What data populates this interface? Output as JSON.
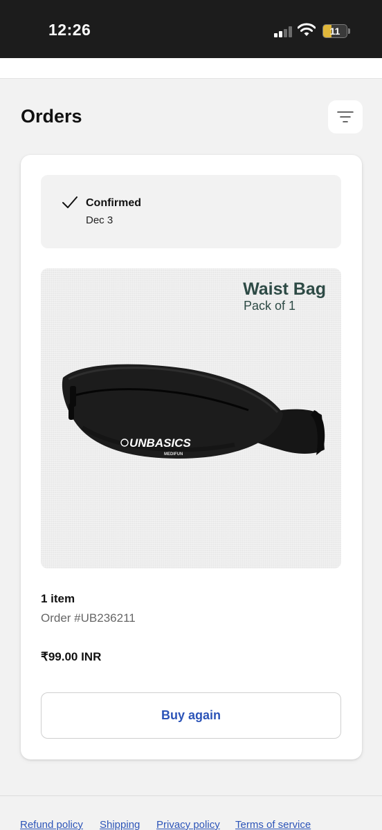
{
  "status_bar": {
    "time": "12:26",
    "battery_level": "11",
    "icons": [
      "signal-icon",
      "wifi-icon",
      "battery-icon"
    ]
  },
  "header": {
    "title": "Orders",
    "filter_icon": "filter-icon"
  },
  "order": {
    "status": "Confirmed",
    "status_icon": "check-icon",
    "date": "Dec 3",
    "product_image": {
      "title": "Waist Bag",
      "subtitle": "Pack of 1",
      "brand_text": "UNBASICS",
      "brand_sub": "MEDIFUN"
    },
    "item_count": "1 item",
    "order_number": "Order #UB236211",
    "price": "₹99.00 INR",
    "buy_again_label": "Buy again"
  },
  "footer": {
    "links": [
      "Refund policy",
      "Shipping",
      "Privacy policy",
      "Terms of service"
    ]
  },
  "colors": {
    "link_blue": "#2c54b8",
    "product_title_green": "#2d4a45",
    "status_bar_bg": "#1c1c1c",
    "page_bg": "#f2f2f2"
  }
}
